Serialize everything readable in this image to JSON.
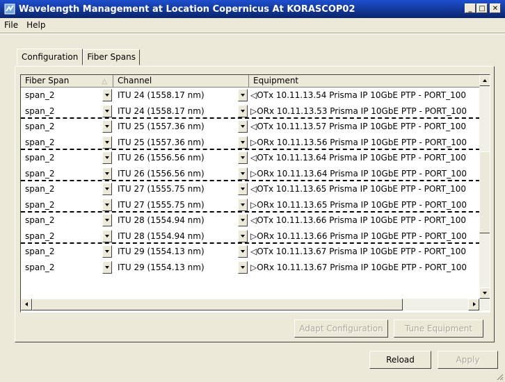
{
  "window": {
    "title": "Wavelength Management at Location Copernicus At KORASCOP02",
    "minimize": "_",
    "maximize": "□",
    "close": "✕"
  },
  "menu": {
    "file": "File",
    "help": "Help"
  },
  "tabs": [
    {
      "label": "Configuration"
    },
    {
      "label": "Fiber Spans"
    }
  ],
  "table": {
    "columns": [
      "Fiber Span",
      "Channel",
      "Equipment"
    ],
    "sort_indicator": "△",
    "rows": [
      {
        "span": "span_2",
        "channel": "ITU 24 (1558.17 nm)",
        "equipment": "◁OTx  10.11.13.54 Prisma IP 10GbE PTP - PORT_100",
        "dash": false
      },
      {
        "span": "span_2",
        "channel": "ITU 24 (1558.17 nm)",
        "equipment": "▷ORx  10.11.13.53 Prisma IP 10GbE PTP - PORT_100",
        "dash": true
      },
      {
        "span": "span_2",
        "channel": "ITU 25 (1557.36 nm)",
        "equipment": "◁OTx  10.11.13.57 Prisma IP 10GbE PTP - PORT_100",
        "dash": false
      },
      {
        "span": "span_2",
        "channel": "ITU 25 (1557.36 nm)",
        "equipment": "▷ORx  10.11.13.56 Prisma IP 10GbE PTP - PORT_100",
        "dash": true
      },
      {
        "span": "span_2",
        "channel": "ITU 26 (1556.56 nm)",
        "equipment": "◁OTx  10.11.13.64 Prisma IP 10GbE PTP - PORT_100",
        "dash": false
      },
      {
        "span": "span_2",
        "channel": "ITU 26 (1556.56 nm)",
        "equipment": "▷ORx  10.11.13.64 Prisma IP 10GbE PTP - PORT_100",
        "dash": true
      },
      {
        "span": "span_2",
        "channel": "ITU 27 (1555.75 nm)",
        "equipment": "◁OTx  10.11.13.65 Prisma IP 10GbE PTP - PORT_100",
        "dash": false
      },
      {
        "span": "span_2",
        "channel": "ITU 27 (1555.75 nm)",
        "equipment": "▷ORx  10.11.13.65 Prisma IP 10GbE PTP - PORT_100",
        "dash": true
      },
      {
        "span": "span_2",
        "channel": "ITU 28 (1554.94 nm)",
        "equipment": "◁OTx  10.11.13.66 Prisma IP 10GbE PTP - PORT_100",
        "dash": false
      },
      {
        "span": "span_2",
        "channel": "ITU 28 (1554.94 nm)",
        "equipment": "▷ORx  10.11.13.66 Prisma IP 10GbE PTP - PORT_100",
        "dash": true
      },
      {
        "span": "span_2",
        "channel": "ITU 29 (1554.13 nm)",
        "equipment": "◁OTx  10.11.13.67 Prisma IP 10GbE PTP - PORT_100",
        "dash": false
      },
      {
        "span": "span_2",
        "channel": "ITU 29 (1554.13 nm)",
        "equipment": "▷ORx  10.11.13.67 Prisma IP 10GbE PTP - PORT_100",
        "dash": false
      }
    ]
  },
  "buttons": {
    "adapt": "Adapt Configuration",
    "tune": "Tune Equipment",
    "reload": "Reload",
    "apply": "Apply"
  },
  "colors": {
    "title_bar": "#0a246a",
    "face": "#ece9d8",
    "disabled_text": "#aca899"
  }
}
